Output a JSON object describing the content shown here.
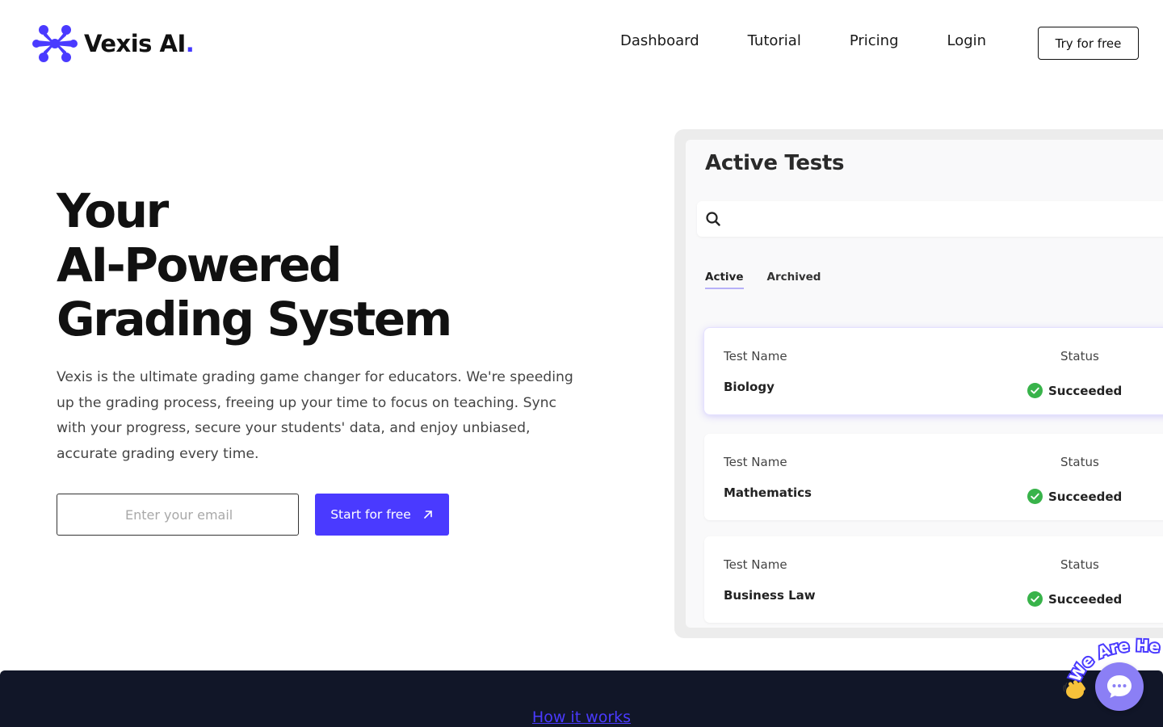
{
  "brand": {
    "name": "Vexis AI",
    "dot": ".",
    "accent": "#4a3aff"
  },
  "nav": {
    "items": [
      {
        "label": "Dashboard"
      },
      {
        "label": "Tutorial"
      },
      {
        "label": "Pricing"
      },
      {
        "label": "Login"
      }
    ],
    "cta": "Try for free"
  },
  "hero": {
    "title_lines": [
      "Your",
      "AI-Powered",
      "Grading System"
    ],
    "description": "Vexis is the ultimate grading game changer for educators. We're speeding up the grading process, freeing up your time to focus on teaching. Sync with your progress, secure your students' data, and enjoy unbiased, accurate grading every time.",
    "email_placeholder": "Enter your email",
    "start_button": "Start for free"
  },
  "preview": {
    "title": "Active Tests",
    "tabs": [
      {
        "label": "Active",
        "active": true
      },
      {
        "label": "Archived",
        "active": false
      }
    ],
    "tests": [
      {
        "name_label": "Test Name",
        "name": "Biology",
        "status_label": "Status",
        "status": "Succeeded",
        "selected": true
      },
      {
        "name_label": "Test Name",
        "name": "Mathematics",
        "status_label": "Status",
        "status": "Succeeded",
        "selected": false
      },
      {
        "name_label": "Test Name",
        "name": "Business Law",
        "status_label": "Status",
        "status": "Succeeded",
        "selected": false
      }
    ],
    "status_color": "#38b34a"
  },
  "footer": {
    "how_it_works": "How it works"
  },
  "chat": {
    "badge_text": "We Are Here!",
    "icon": "chat-bubble-icon",
    "color": "#8b7ff5"
  }
}
